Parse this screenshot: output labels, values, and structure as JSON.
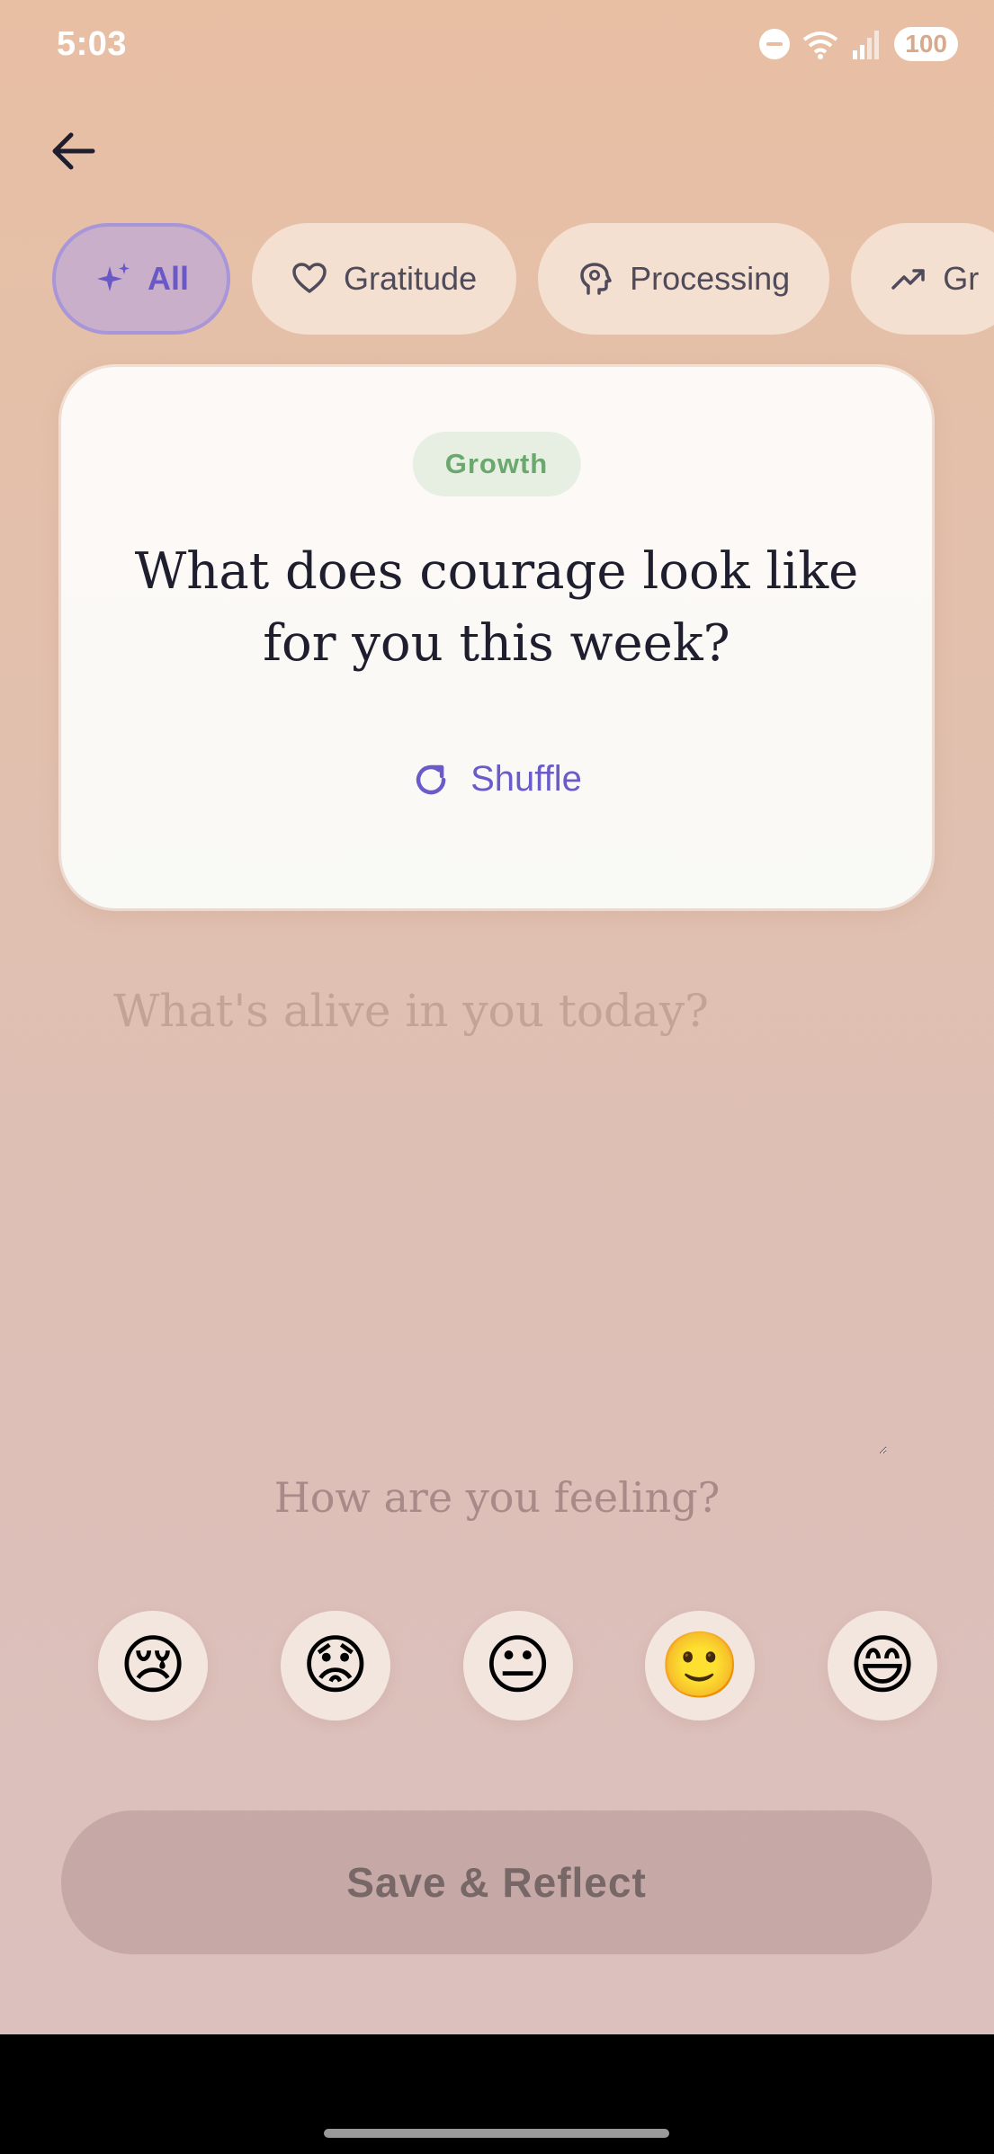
{
  "status_bar": {
    "time": "5:03",
    "battery": "100"
  },
  "filters": [
    {
      "label": "All",
      "icon": "sparkle-icon",
      "active": true
    },
    {
      "label": "Gratitude",
      "icon": "heart-icon",
      "active": false
    },
    {
      "label": "Processing",
      "icon": "brain-icon",
      "active": false
    },
    {
      "label": "Gr",
      "icon": "trending-up-icon",
      "active": false
    }
  ],
  "prompt_card": {
    "tag": "Growth",
    "question": "What does courage look like for you this week?",
    "shuffle_label": "Shuffle"
  },
  "journal": {
    "placeholder": "What's alive in you today?"
  },
  "mood": {
    "question": "How are you feeling?",
    "options": [
      "😢",
      "😟",
      "😐",
      "🙂",
      "😄"
    ]
  },
  "save_button": "Save & Reflect",
  "colors": {
    "accent": "#6a5bcb",
    "tag_green": "#6aa86d"
  }
}
